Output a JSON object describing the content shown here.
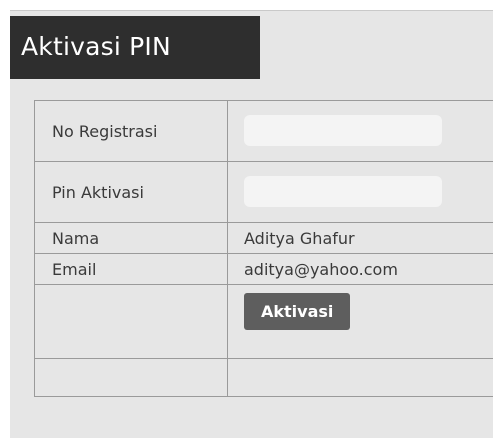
{
  "page": {
    "title": "Aktivasi PIN"
  },
  "form": {
    "rows": [
      {
        "label": "No Registrasi",
        "input_value": ""
      },
      {
        "label": "Pin Aktivasi",
        "input_value": ""
      },
      {
        "label": "Nama",
        "value": "Aditya Ghafur"
      },
      {
        "label": "Email",
        "value": "aditya@yahoo.com"
      }
    ],
    "submit_label": "Aktivasi"
  },
  "colors": {
    "title_bg": "#2e2e2e",
    "panel_bg": "#e6e6e6",
    "button_bg": "#5e5e5e",
    "input_bg": "#f4f4f4"
  }
}
